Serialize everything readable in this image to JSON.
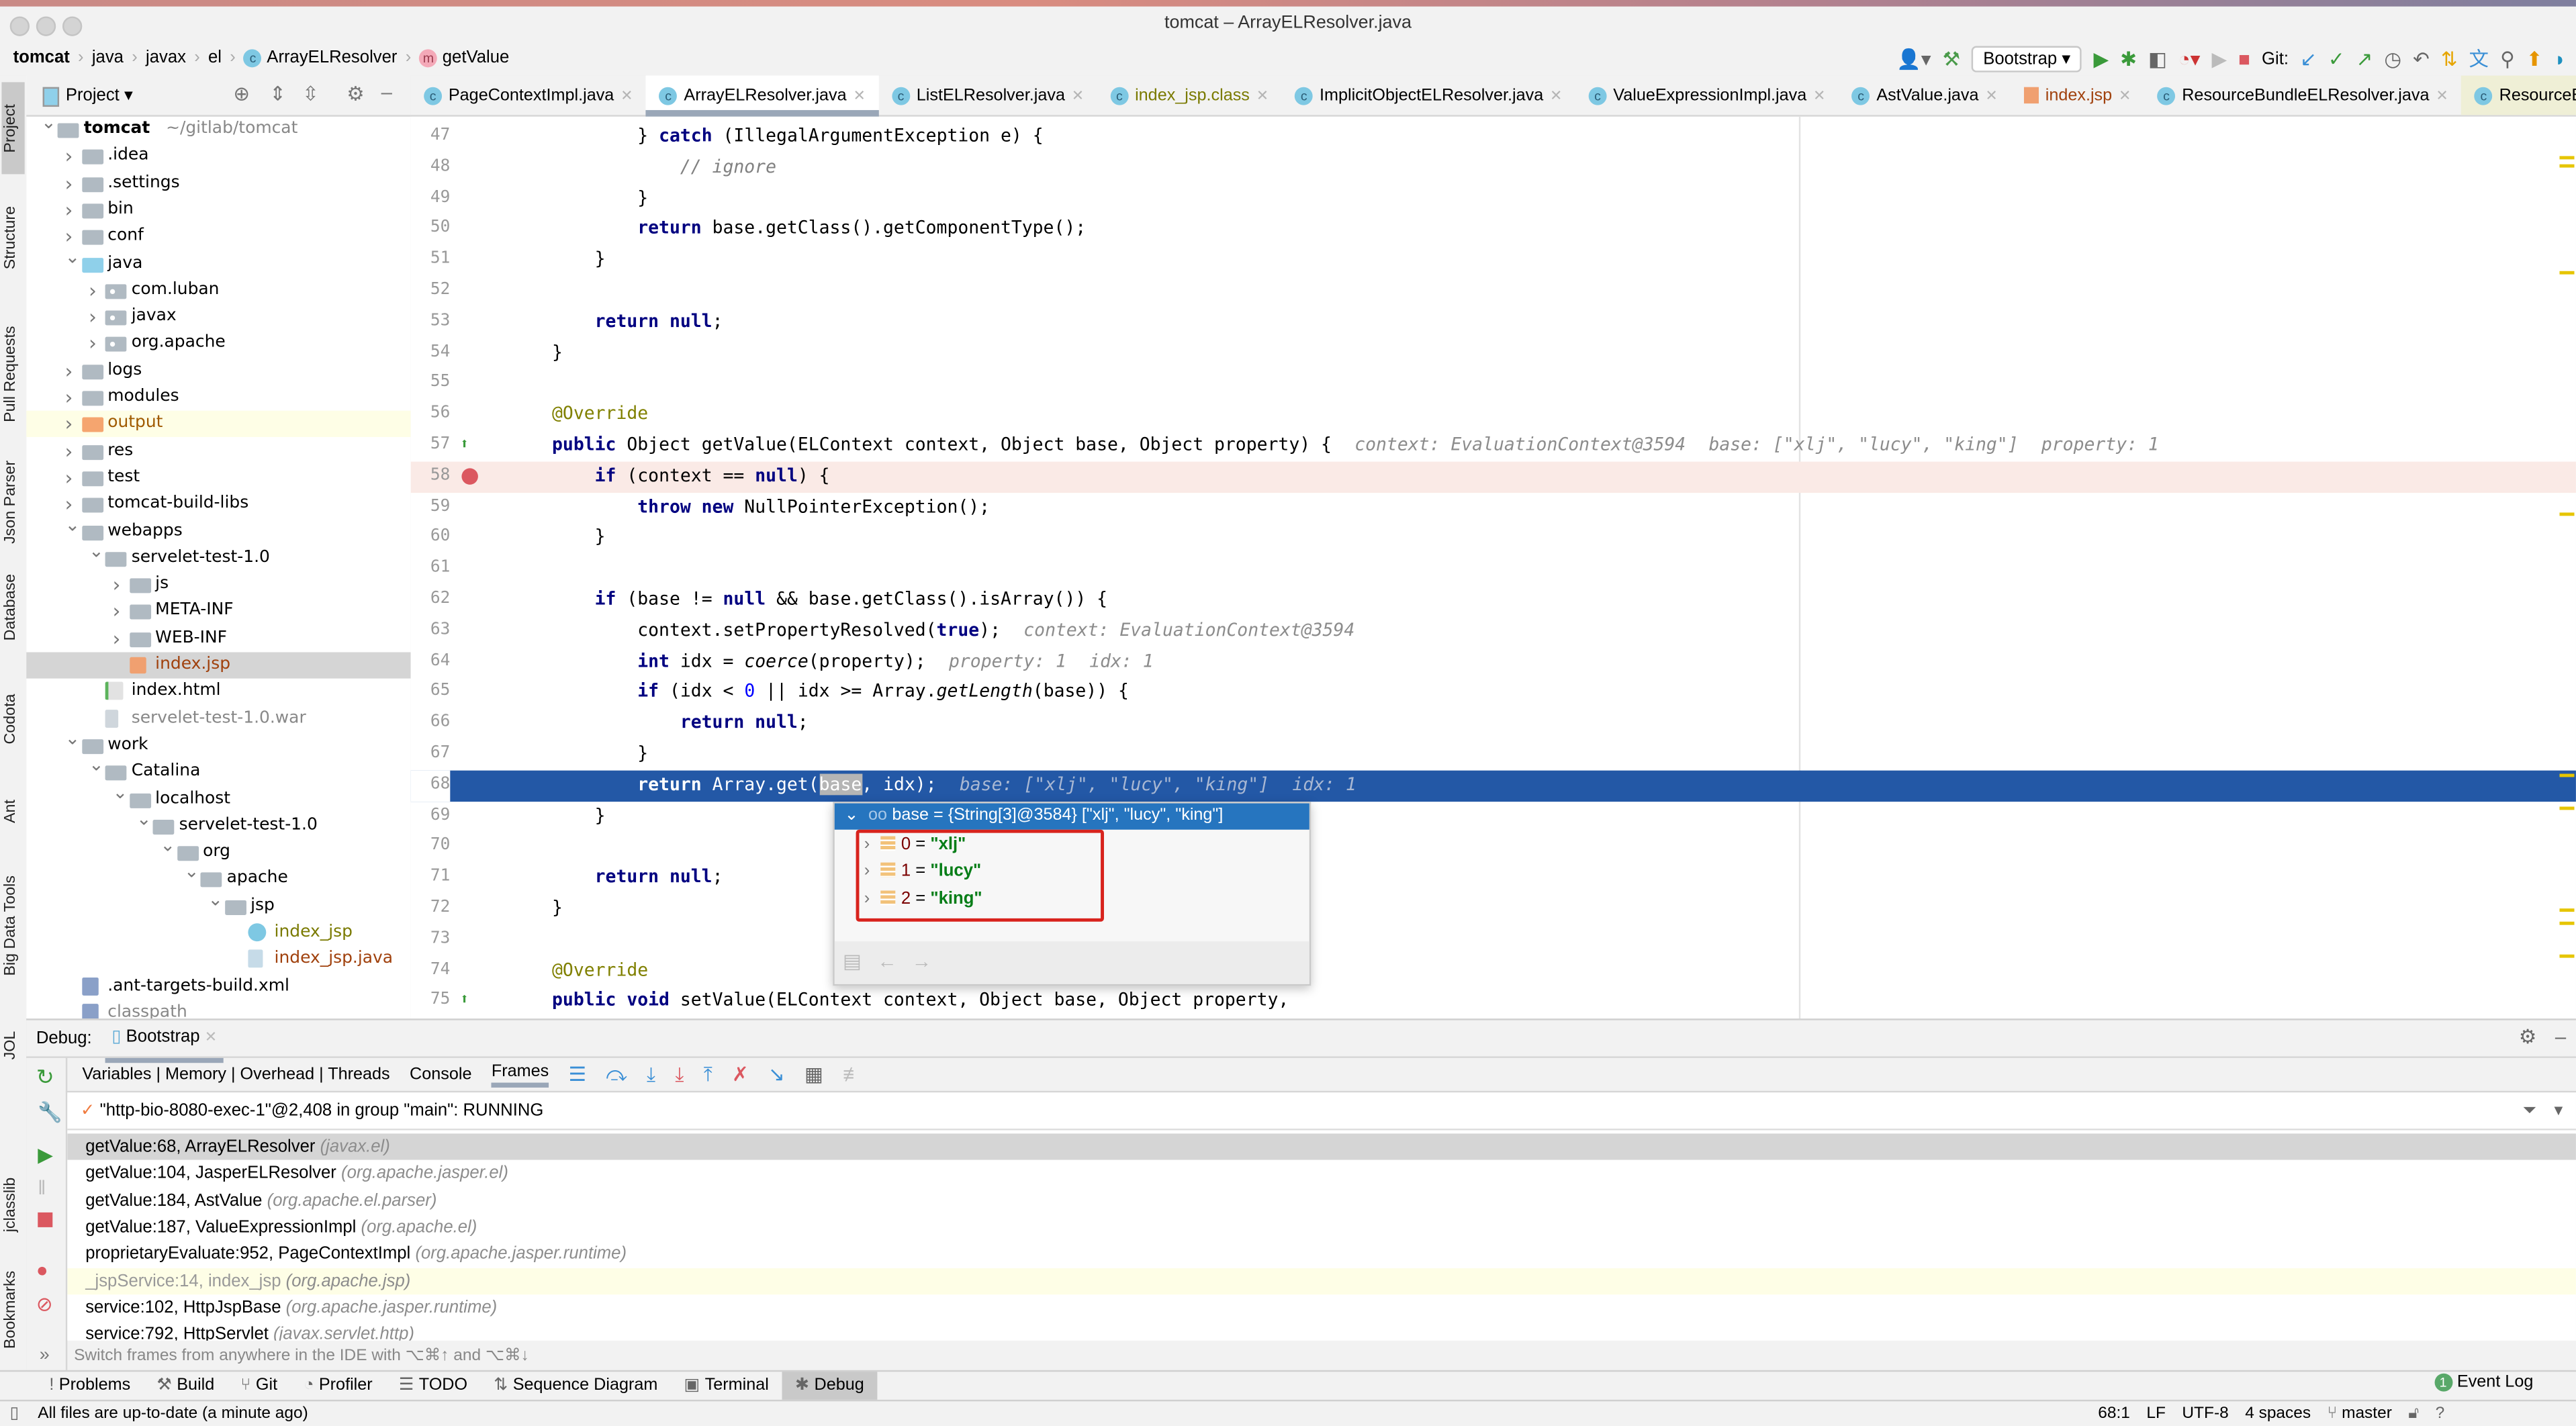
{
  "window": {
    "title": "tomcat – ArrayELResolver.java"
  },
  "breadcrumb": [
    {
      "label": "tomcat",
      "bold": true
    },
    {
      "label": "java"
    },
    {
      "label": "javax"
    },
    {
      "label": "el"
    },
    {
      "label": "ArrayELResolver",
      "icon": "class-icon"
    },
    {
      "label": "getValue",
      "icon": "method-icon"
    }
  ],
  "toolbar": {
    "run_config": "Bootstrap",
    "git_label": "Git:",
    "icons": [
      "user-icon",
      "build-hammer-icon",
      "run-icon",
      "debug-icon",
      "coverage-icon",
      "profile-icon",
      "run-disabled-icon",
      "stop-icon",
      "git-update-icon",
      "git-commit-icon",
      "git-push-icon",
      "history-icon",
      "rollback-icon",
      "sequence-diagram-icon",
      "translate-icon",
      "search-icon",
      "update-icon",
      "plugin-icon"
    ]
  },
  "left_stripe": [
    "Project",
    "Structure",
    "Pull Requests",
    "Json Parser",
    "Database",
    "Codota",
    "Ant",
    "Big Data Tools",
    "JOL",
    "jclasslib",
    "Bookmarks"
  ],
  "project": {
    "title": "Project",
    "tree": [
      {
        "d": 0,
        "a": "open",
        "t": "folder",
        "l": "tomcat",
        "bold": true,
        "hint": "~/gitlab/tomcat"
      },
      {
        "d": 1,
        "a": "closed",
        "t": "folder",
        "l": ".idea"
      },
      {
        "d": 1,
        "a": "closed",
        "t": "folder",
        "l": ".settings"
      },
      {
        "d": 1,
        "a": "closed",
        "t": "folder",
        "l": "bin"
      },
      {
        "d": 1,
        "a": "closed",
        "t": "folder",
        "l": "conf"
      },
      {
        "d": 1,
        "a": "open",
        "t": "folder blue",
        "l": "java"
      },
      {
        "d": 2,
        "a": "closed",
        "t": "folder pkg",
        "l": "com.luban"
      },
      {
        "d": 2,
        "a": "closed",
        "t": "folder pkg",
        "l": "javax"
      },
      {
        "d": 2,
        "a": "closed",
        "t": "folder pkg",
        "l": "org.apache"
      },
      {
        "d": 1,
        "a": "closed",
        "t": "folder",
        "l": "logs"
      },
      {
        "d": 1,
        "a": "closed",
        "t": "folder",
        "l": "modules"
      },
      {
        "d": 1,
        "a": "closed",
        "t": "folder orange",
        "l": "output",
        "color": "#a05a00",
        "hl": true
      },
      {
        "d": 1,
        "a": "closed",
        "t": "folder",
        "l": "res"
      },
      {
        "d": 1,
        "a": "closed",
        "t": "folder",
        "l": "test"
      },
      {
        "d": 1,
        "a": "closed",
        "t": "folder",
        "l": "tomcat-build-libs"
      },
      {
        "d": 1,
        "a": "open",
        "t": "folder",
        "l": "webapps"
      },
      {
        "d": 2,
        "a": "open",
        "t": "folder",
        "l": "servelet-test-1.0"
      },
      {
        "d": 3,
        "a": "closed",
        "t": "folder",
        "l": "js"
      },
      {
        "d": 3,
        "a": "closed",
        "t": "folder",
        "l": "META-INF"
      },
      {
        "d": 3,
        "a": "closed",
        "t": "folder",
        "l": "WEB-INF"
      },
      {
        "d": 3,
        "a": "",
        "t": "jsp",
        "l": "index.jsp",
        "color": "#a0410d",
        "sel": true
      },
      {
        "d": 2,
        "a": "",
        "t": "html",
        "l": "index.html"
      },
      {
        "d": 2,
        "a": "",
        "t": "war",
        "l": "servelet-test-1.0.war",
        "color": "#888888"
      },
      {
        "d": 1,
        "a": "open",
        "t": "folder",
        "l": "work"
      },
      {
        "d": 2,
        "a": "open",
        "t": "folder",
        "l": "Catalina"
      },
      {
        "d": 3,
        "a": "open",
        "t": "folder",
        "l": "localhost"
      },
      {
        "d": 4,
        "a": "open",
        "t": "folder",
        "l": "servelet-test-1.0"
      },
      {
        "d": 5,
        "a": "open",
        "t": "folder",
        "l": "org"
      },
      {
        "d": 6,
        "a": "open",
        "t": "folder",
        "l": "apache"
      },
      {
        "d": 7,
        "a": "open",
        "t": "folder",
        "l": "jsp"
      },
      {
        "d": 8,
        "a": "",
        "t": "cls",
        "l": "index_jsp",
        "color": "#7a7a00"
      },
      {
        "d": 8,
        "a": "",
        "t": "java",
        "l": "index_jsp.java",
        "color": "#a0410d"
      },
      {
        "d": 1,
        "a": "",
        "t": "xml",
        "l": ".ant-targets-build.xml"
      },
      {
        "d": 1,
        "a": "",
        "t": "xml",
        "l": "classpath",
        "color": "#888888"
      }
    ]
  },
  "tabs": [
    {
      "label": "PageContextImpl.java"
    },
    {
      "label": "ArrayELResolver.java",
      "active": true
    },
    {
      "label": "ListELResolver.java"
    },
    {
      "label": "index_jsp.class",
      "color": "#7a7a00"
    },
    {
      "label": "ImplicitObjectELResolver.java"
    },
    {
      "label": "ValueExpressionImpl.java"
    },
    {
      "label": "AstValue.java"
    },
    {
      "label": "index.jsp",
      "color": "#a0410d",
      "jsp": true
    },
    {
      "label": "ResourceBundleELResolver.java"
    },
    {
      "label": "ResourceBundle...",
      "pinned": true,
      "noclose": true
    }
  ],
  "inspections": {
    "warnings": "7",
    "weak_warnings": "1"
  },
  "code": [
    {
      "n": "47",
      "ind": 12,
      "tk": [
        [
          "} ",
          "p"
        ],
        [
          "catch",
          "k"
        ],
        [
          " (IllegalArgumentException e) {",
          "p"
        ]
      ]
    },
    {
      "n": "48",
      "ind": 16,
      "tk": [
        [
          "// ignore",
          "cm"
        ]
      ]
    },
    {
      "n": "49",
      "ind": 12,
      "tk": [
        [
          "}",
          "p"
        ]
      ]
    },
    {
      "n": "50",
      "ind": 12,
      "tk": [
        [
          "return",
          "k"
        ],
        [
          " base.getClass().getComponentType();",
          "p"
        ]
      ]
    },
    {
      "n": "51",
      "ind": 8,
      "tk": [
        [
          "}",
          "p"
        ]
      ]
    },
    {
      "n": "52",
      "ind": 0,
      "tk": []
    },
    {
      "n": "53",
      "ind": 8,
      "tk": [
        [
          "return null",
          "k"
        ],
        [
          ";",
          "p"
        ]
      ]
    },
    {
      "n": "54",
      "ind": 4,
      "tk": [
        [
          "}",
          "p"
        ]
      ]
    },
    {
      "n": "55",
      "ind": 0,
      "tk": []
    },
    {
      "n": "56",
      "ind": 4,
      "tk": [
        [
          "@Override",
          "a"
        ]
      ]
    },
    {
      "n": "57",
      "ind": 4,
      "tk": [
        [
          "public",
          "k"
        ],
        [
          " Object getValue(ELContext context, Object base, Object property) {",
          "p"
        ]
      ],
      "hints": [
        "context: EvaluationContext@3594",
        "base: [\"xlj\", \"lucy\", \"king\"]",
        "property: 1"
      ],
      "gutter": "override"
    },
    {
      "n": "58",
      "ind": 8,
      "tk": [
        [
          "if",
          "k"
        ],
        [
          " (context == ",
          "p"
        ],
        [
          "null",
          "k"
        ],
        [
          ") {",
          "p"
        ]
      ],
      "bp": true,
      "gutter": "breakpoint"
    },
    {
      "n": "59",
      "ind": 12,
      "tk": [
        [
          "throw new",
          "k"
        ],
        [
          " NullPointerException();",
          "p"
        ]
      ]
    },
    {
      "n": "60",
      "ind": 8,
      "tk": [
        [
          "}",
          "p"
        ]
      ]
    },
    {
      "n": "61",
      "ind": 0,
      "tk": []
    },
    {
      "n": "62",
      "ind": 8,
      "tk": [
        [
          "if",
          "k"
        ],
        [
          " (base != ",
          "p"
        ],
        [
          "null",
          "k"
        ],
        [
          " && base.getClass().isArray()) {",
          "p"
        ]
      ]
    },
    {
      "n": "63",
      "ind": 12,
      "tk": [
        [
          "context.setPropertyResolved(",
          "p"
        ],
        [
          "true",
          "k"
        ],
        [
          ");",
          "p"
        ]
      ],
      "hints": [
        "context: EvaluationContext@3594"
      ]
    },
    {
      "n": "64",
      "ind": 12,
      "tk": [
        [
          "int",
          "k"
        ],
        [
          " idx = ",
          "p"
        ],
        [
          "coerce",
          "i"
        ],
        [
          "(property);",
          "p"
        ]
      ],
      "hints": [
        "property: 1",
        "idx: 1"
      ]
    },
    {
      "n": "65",
      "ind": 12,
      "tk": [
        [
          "if",
          "k"
        ],
        [
          " (idx < ",
          "p"
        ],
        [
          "0",
          "n"
        ],
        [
          " || idx >= Array.",
          "p"
        ],
        [
          "getLength",
          "i"
        ],
        [
          "(base)) {",
          "p"
        ]
      ]
    },
    {
      "n": "66",
      "ind": 16,
      "tk": [
        [
          "return null",
          "k"
        ],
        [
          ";",
          "p"
        ]
      ]
    },
    {
      "n": "67",
      "ind": 12,
      "tk": [
        [
          "}",
          "p"
        ]
      ]
    },
    {
      "n": "68",
      "ind": 12,
      "tk": [
        [
          "return",
          "k"
        ],
        [
          " Array.get(",
          "p"
        ],
        [
          "base",
          "sel-word"
        ],
        [
          ", idx);",
          "p"
        ]
      ],
      "hints": [
        "base: [\"xlj\", \"lucy\", \"king\"]",
        "idx: 1"
      ],
      "cur": true
    },
    {
      "n": "69",
      "ind": 8,
      "tk": [
        [
          "}",
          "p"
        ]
      ]
    },
    {
      "n": "70",
      "ind": 0,
      "tk": []
    },
    {
      "n": "71",
      "ind": 8,
      "tk": [
        [
          "return null",
          "k"
        ],
        [
          ";",
          "p"
        ]
      ]
    },
    {
      "n": "72",
      "ind": 4,
      "tk": [
        [
          "}",
          "p"
        ]
      ]
    },
    {
      "n": "73",
      "ind": 0,
      "tk": []
    },
    {
      "n": "74",
      "ind": 4,
      "tk": [
        [
          "@Override",
          "a"
        ]
      ]
    },
    {
      "n": "75",
      "ind": 4,
      "tk": [
        [
          "public void",
          "k"
        ],
        [
          " setValue(ELContext context, Object base, Object property,",
          "p"
        ]
      ],
      "gutter": "override"
    }
  ],
  "popup": {
    "header": "base = {String[3]@3584} [\"xlj\", \"lucy\", \"king\"]",
    "items": [
      {
        "idx": "0",
        "val": "\"xlj\""
      },
      {
        "idx": "1",
        "val": "\"lucy\""
      },
      {
        "idx": "2",
        "val": "\"king\""
      }
    ],
    "highlight_color": "#d8231d"
  },
  "debug": {
    "label": "Debug:",
    "session": "Bootstrap",
    "tabs": [
      "Variables | Memory | Overhead | Threads",
      "Console",
      "Frames"
    ],
    "active_tab": "Frames",
    "thread": "\"http-bio-8080-exec-1\"@2,408 in group \"main\": RUNNING",
    "frames": [
      {
        "m": "getValue:68, ArrayELResolver",
        "p": "(javax.el)",
        "sel": true
      },
      {
        "m": "getValue:104, JasperELResolver",
        "p": "(org.apache.jasper.el)"
      },
      {
        "m": "getValue:184, AstValue",
        "p": "(org.apache.el.parser)"
      },
      {
        "m": "getValue:187, ValueExpressionImpl",
        "p": "(org.apache.el)"
      },
      {
        "m": "proprietaryEvaluate:952, PageContextImpl",
        "p": "(org.apache.jasper.runtime)"
      },
      {
        "m": "_jspService:14, index_jsp",
        "p": "(org.apache.jsp)",
        "lib": true
      },
      {
        "m": "service:102, HttpJspBase",
        "p": "(org.apache.jasper.runtime)"
      },
      {
        "m": "service:792, HttpServlet",
        "p": "(javax.servlet.http)"
      }
    ],
    "hint": "Switch frames from anywhere in the IDE with ⌥⌘↑ and ⌥⌘↓"
  },
  "bottom_tools": [
    {
      "label": "Problems",
      "icon": "!"
    },
    {
      "label": "Build",
      "icon": "⚒"
    },
    {
      "label": "Git",
      "icon": "⑂"
    },
    {
      "label": "Profiler",
      "icon": "◔"
    },
    {
      "label": "TODO",
      "icon": "☰"
    },
    {
      "label": "Sequence Diagram",
      "icon": "⇅"
    },
    {
      "label": "Terminal",
      "icon": "▣"
    },
    {
      "label": "Debug",
      "icon": "✱",
      "active": true
    }
  ],
  "event_log": {
    "label": "Event Log",
    "count": "1"
  },
  "status": {
    "message": "All files are up-to-date (a minute ago)",
    "position": "68:1",
    "line_sep": "LF",
    "encoding": "UTF-8",
    "indent": "4 spaces",
    "branch": "master"
  }
}
